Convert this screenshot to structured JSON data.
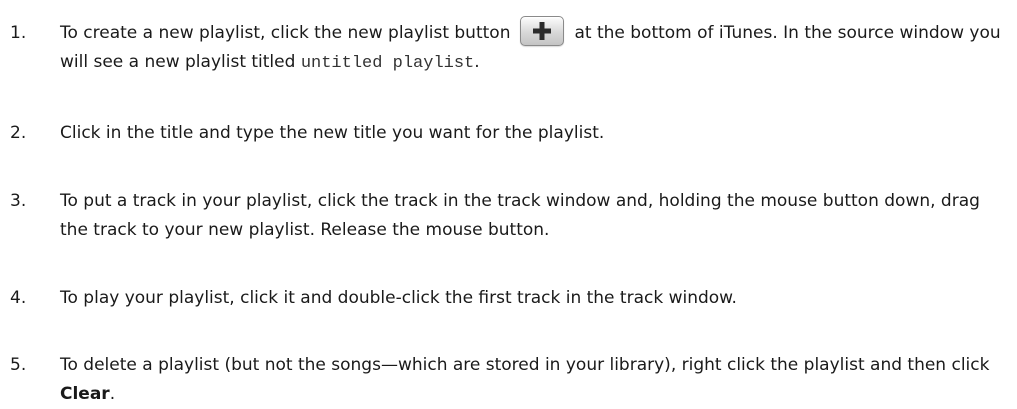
{
  "steps": [
    {
      "number": "1.",
      "text_before": "To create a new playlist, click the new playlist button",
      "button_icon": "plus-icon",
      "text_after": "at the bottom of iTunes. In the source window you will see a new playlist titled",
      "code_text": "untitled playlist",
      "text_end": "."
    },
    {
      "number": "2.",
      "text": "Click in the title and type the new title you want for the playlist."
    },
    {
      "number": "3.",
      "text": "To put a track in your playlist, click the track in the track window and, holding the mouse button down, drag the track to your new playlist. Release the mouse button."
    },
    {
      "number": "4.",
      "text": "To play your playlist, click it and double-click the first track in the track window."
    },
    {
      "number": "5.",
      "text_before": "To delete a playlist (but not the songs—which are stored in your library), right click the playlist and then click",
      "bold_text": "Clear",
      "text_end": "."
    }
  ]
}
